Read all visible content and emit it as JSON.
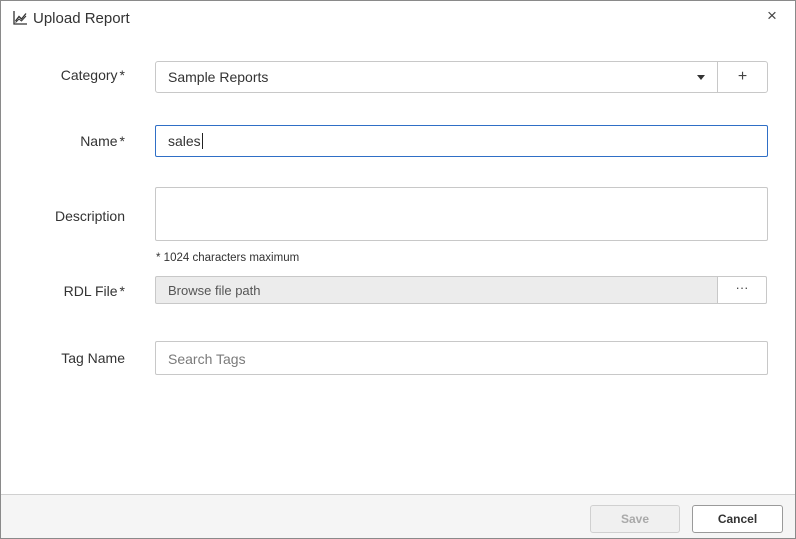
{
  "dialog": {
    "title": "Upload Report",
    "title_icon": "line-chart-icon",
    "close_glyph": "×"
  },
  "form": {
    "category": {
      "label": "Category",
      "required_mark": "*",
      "value": "Sample Reports",
      "add_glyph": "+"
    },
    "name": {
      "label": "Name",
      "required_mark": "*",
      "value": "sales"
    },
    "description": {
      "label": "Description",
      "value": "",
      "hint": "* 1024 characters maximum"
    },
    "rdl_file": {
      "label": "RDL File",
      "required_mark": "*",
      "placeholder": "Browse file path",
      "browse_glyph": "···"
    },
    "tag_name": {
      "label": "Tag Name",
      "placeholder": "Search Tags"
    }
  },
  "footer": {
    "save_label": "Save",
    "cancel_label": "Cancel"
  },
  "colors": {
    "focus_border": "#2f6fc6",
    "disabled_text": "#a9a9a9",
    "field_border": "#c8c8c8"
  }
}
